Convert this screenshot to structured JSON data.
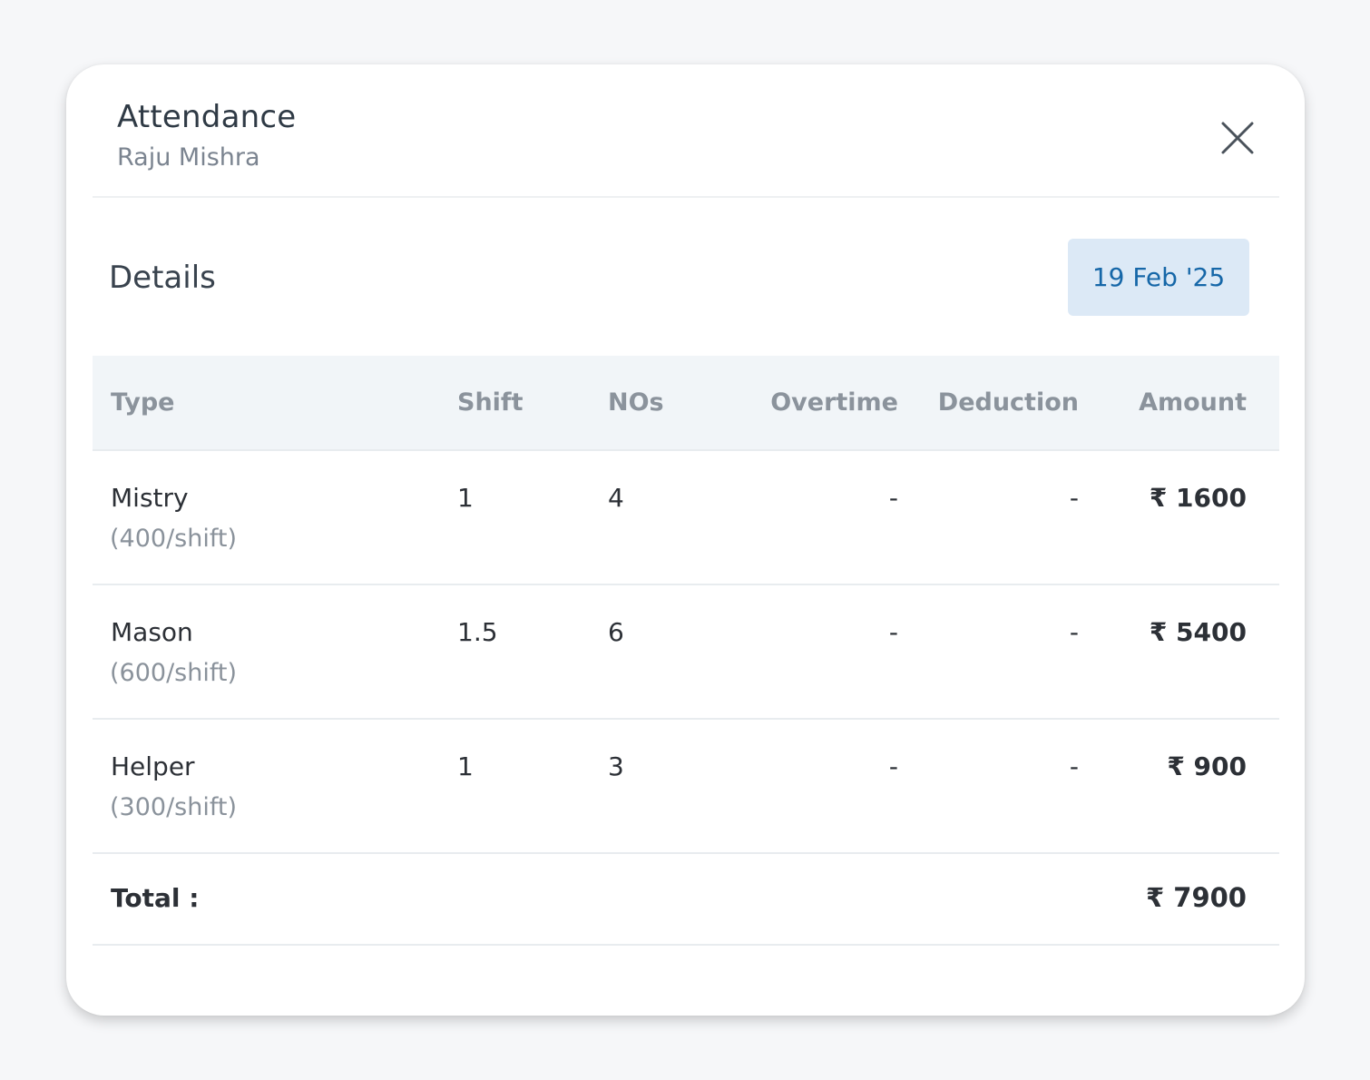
{
  "modal": {
    "title": "Attendance",
    "subtitle": "Raju Mishra",
    "close_icon": "close-icon"
  },
  "details": {
    "section_title": "Details",
    "date": "19 Feb '25"
  },
  "table": {
    "headers": {
      "type": "Type",
      "shift": "Shift",
      "nos": "NOs",
      "overtime": "Overtime",
      "deduction": "Deduction",
      "amount": "Amount"
    },
    "rows": [
      {
        "type": "Mistry",
        "rate": "(400/shift)",
        "shift": "1",
        "nos": "4",
        "overtime": "-",
        "deduction": "-",
        "amount": "₹ 1600"
      },
      {
        "type": "Mason",
        "rate": "(600/shift)",
        "shift": "1.5",
        "nos": "6",
        "overtime": "-",
        "deduction": "-",
        "amount": "₹ 5400"
      },
      {
        "type": "Helper",
        "rate": "(300/shift)",
        "shift": "1",
        "nos": "3",
        "overtime": "-",
        "deduction": "-",
        "amount": "₹ 900"
      }
    ],
    "total_label": "Total :",
    "total_value": "₹ 7900"
  },
  "colors": {
    "badge_bg": "#dce9f6",
    "badge_text": "#1667a8",
    "header_bg": "#f1f5f8"
  }
}
